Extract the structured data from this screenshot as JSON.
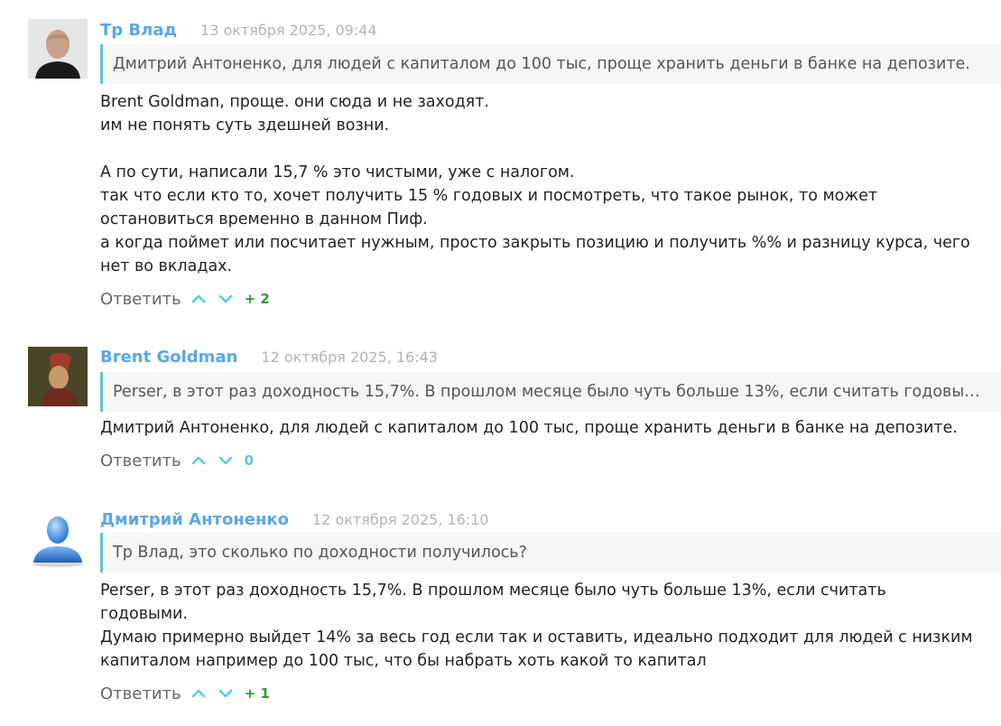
{
  "comments": [
    {
      "author": "Тр Влад",
      "date": "13 октября 2025, 09:44",
      "quote": "Дмитрий Антоненко, для людей с капиталом до 100 тыс, проще хранить деньги в банке на депозите.",
      "body": [
        "Brent Goldman, проще. они сюда и не заходят.",
        "им не понять суть здешней возни.",
        "",
        "А по сути, написали 15,7 % это чистыми, уже с налогом.",
        "так что если кто то, хочет получить 15 % годовых и посмотреть, что такое рынок, то может остановиться временно в данном Пиф.",
        "а когда поймет или посчитает нужным, просто закрыть позицию и получить %% и разницу курса, чего нет во вкладах."
      ],
      "reply_label": "Ответить",
      "score": "+ 2",
      "score_color": "#2e9b2e"
    },
    {
      "author": "Brent Goldman",
      "date": "12 октября 2025, 16:43",
      "quote": "Perser, в этот раз доходность 15,7%. В прошлом месяце было чуть больше 13%, если считать годовы…",
      "body": [
        "Дмитрий Антоненко, для людей с капиталом до 100 тыс, проще хранить деньги в банке на депозите."
      ],
      "reply_label": "Ответить",
      "score": "0",
      "score_color": "#5fc8d3"
    },
    {
      "author": "Дмитрий Антоненко",
      "date": "12 октября 2025, 16:10",
      "quote": "Тр Влад, это сколько по доходности получилось?",
      "body": [
        "Perser, в этот раз доходность 15,7%. В прошлом месяце было чуть больше 13%, если считать годовыми.",
        "Думаю примерно выйдет 14% за весь год если так и оставить, идеально подходит для людей с низким капиталом например до 100 тыс, что бы набрать хоть какой то капитал"
      ],
      "reply_label": "Ответить",
      "score": "+ 1",
      "score_color": "#2e9b2e"
    }
  ],
  "colors": {
    "accent": "#5aa7e8",
    "quote_border": "#5fc8d3",
    "vote_arrow": "#4fd0e0"
  },
  "icons": {
    "upvote": "chevron-up-icon",
    "downvote": "chevron-down-icon"
  }
}
